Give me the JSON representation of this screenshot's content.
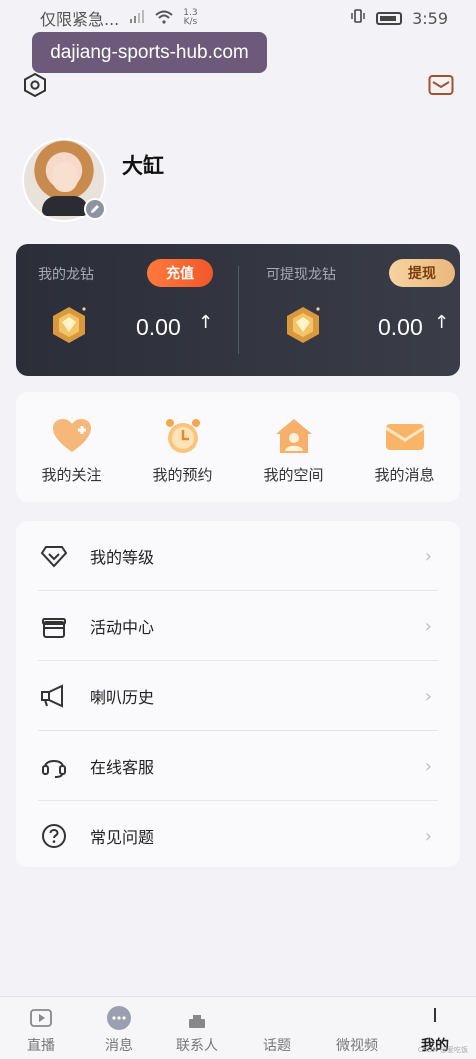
{
  "status_bar": {
    "carrier": "仅限紧急...",
    "net_speed_value": "1.3",
    "net_speed_unit": "K/s",
    "time": "3:59"
  },
  "browser": {
    "url": "dajiang-sports-hub.com"
  },
  "profile": {
    "username": "大缸"
  },
  "wallet": {
    "left": {
      "label": "我的龙钻",
      "button": "充值",
      "amount": "0.00",
      "arrow": "↑"
    },
    "right": {
      "label": "可提现龙钻",
      "button": "提现",
      "amount": "0.00",
      "arrow": "↑"
    },
    "colors": {
      "card": "#2b2e38",
      "recharge": "#f0582a",
      "withdraw": "#eab87c"
    }
  },
  "shortcuts": [
    {
      "label": "我的关注",
      "icon": "heart-plus-icon"
    },
    {
      "label": "我的预约",
      "icon": "alarm-clock-icon"
    },
    {
      "label": "我的空间",
      "icon": "home-user-icon"
    },
    {
      "label": "我的消息",
      "icon": "envelope-icon"
    }
  ],
  "menu": [
    {
      "label": "我的等级",
      "icon": "diamond-level-icon"
    },
    {
      "label": "活动中心",
      "icon": "gift-icon"
    },
    {
      "label": "喇叭历史",
      "icon": "megaphone-icon"
    },
    {
      "label": "在线客服",
      "icon": "headset-icon"
    },
    {
      "label": "常见问题",
      "icon": "question-icon"
    }
  ],
  "tabs": [
    {
      "label": "直播",
      "icon": "play-icon"
    },
    {
      "label": "消息",
      "icon": "chat-icon"
    },
    {
      "label": "联系人",
      "icon": "contacts-icon"
    },
    {
      "label": "话题",
      "icon": "topic-icon"
    },
    {
      "label": "微视频",
      "icon": "video-icon"
    },
    {
      "label": "我的",
      "icon": "me-icon",
      "active": true
    }
  ],
  "watermark": "CSDN @爱吃饭"
}
